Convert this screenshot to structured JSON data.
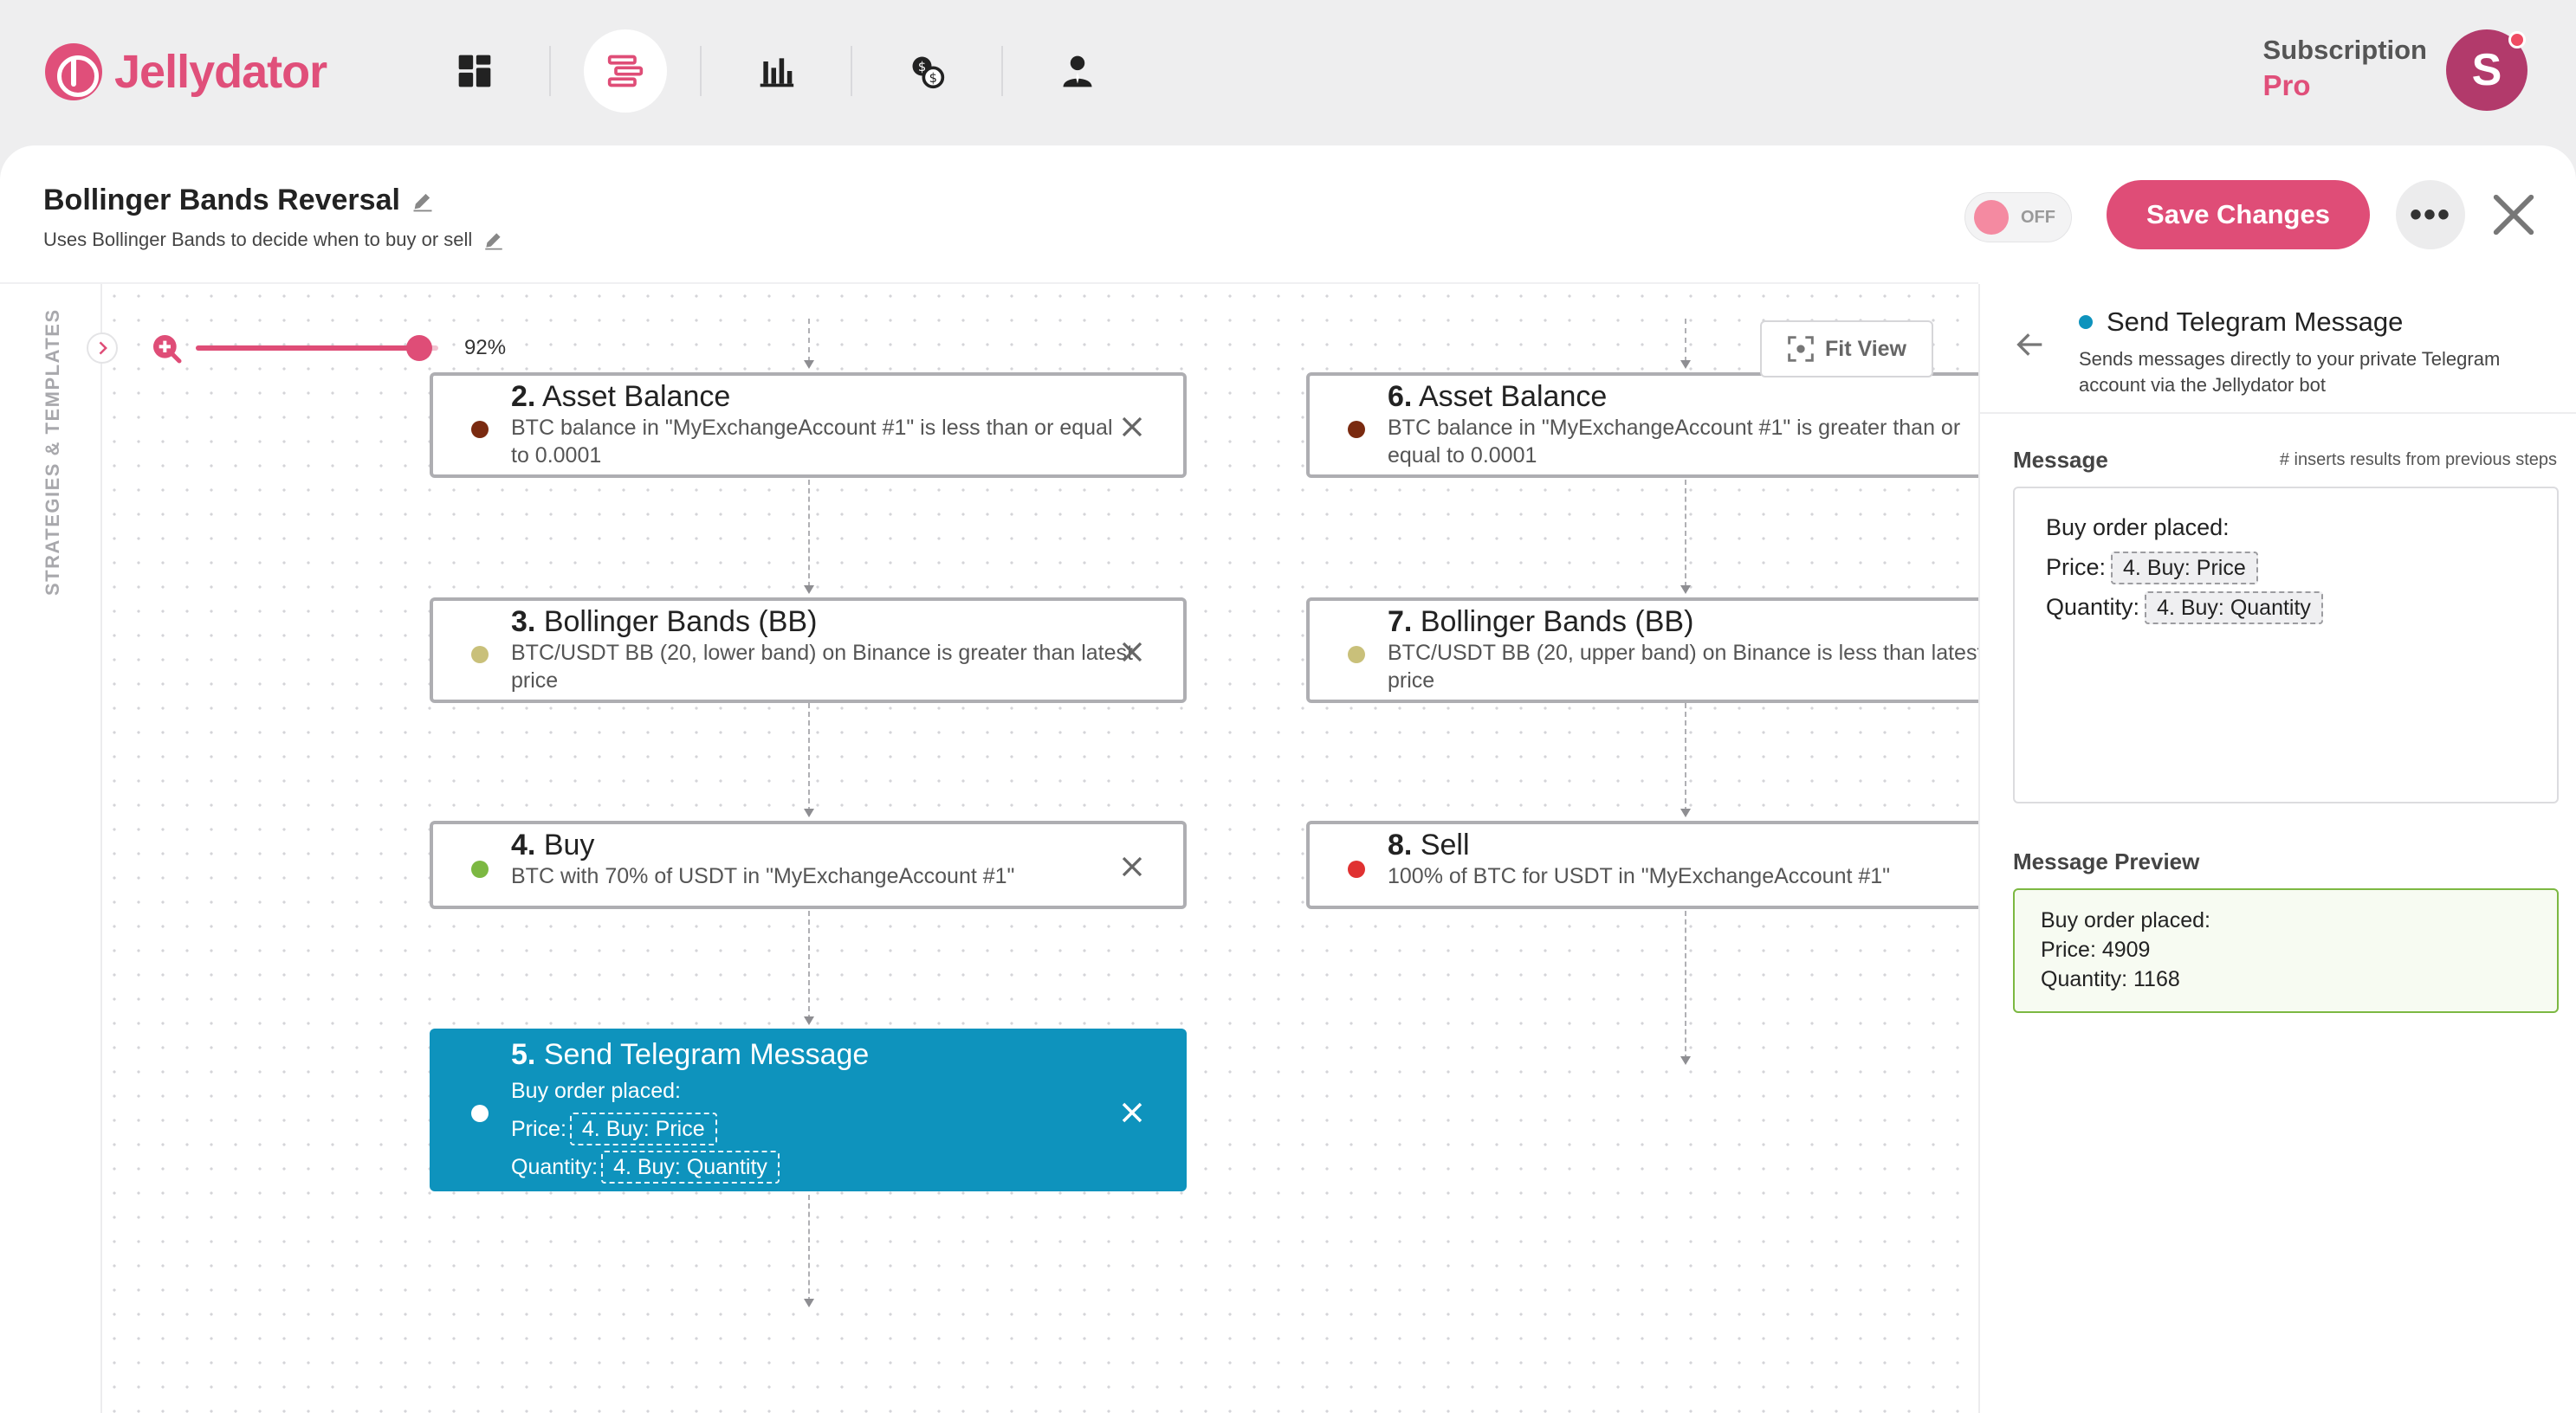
{
  "app": {
    "name": "Jellydator"
  },
  "nav": {
    "items": [
      {
        "icon": "dashboard-icon",
        "active": false
      },
      {
        "icon": "strategies-icon",
        "active": true
      },
      {
        "icon": "bar-chart-icon",
        "active": false
      },
      {
        "icon": "exchange-icon",
        "active": false
      },
      {
        "icon": "account-icon",
        "active": false
      }
    ]
  },
  "subscription": {
    "label": "Subscription",
    "plan": "Pro"
  },
  "user": {
    "avatar_letter": "S"
  },
  "strategy": {
    "title": "Bollinger Bands Reversal",
    "description": "Uses Bollinger Bands to decide when to buy or sell",
    "toggle_label": "OFF",
    "save_label": "Save Changes",
    "more_label": "•••"
  },
  "sidebar": {
    "label": "STRATEGIES & TEMPLATES"
  },
  "canvas": {
    "zoom_value": "92%",
    "zoom_fraction": 0.92,
    "fit_view_label": "Fit View"
  },
  "nodes": {
    "n2": {
      "num": "2.",
      "title": "Asset Balance",
      "desc": "BTC balance in \"MyExchangeAccount #1\" is less than or equal to 0.0001",
      "dot_color": "#7a2a10"
    },
    "n3": {
      "num": "3.",
      "title": "Bollinger Bands (BB)",
      "desc": "BTC/USDT BB (20, lower band) on Binance is greater than latest price",
      "dot_color": "#c9c07a"
    },
    "n4": {
      "num": "4.",
      "title": "Buy",
      "desc": "BTC with 70% of USDT in \"MyExchangeAccount #1\"",
      "dot_color": "#7cb842"
    },
    "n5": {
      "num": "5.",
      "title": "Send Telegram Message",
      "line1": "Buy order placed:",
      "price_label": "Price:",
      "price_token": "4. Buy: Price",
      "qty_label": "Quantity:",
      "qty_token": "4. Buy: Quantity",
      "dot_color": "#ffffff"
    },
    "n6": {
      "num": "6.",
      "title": "Asset Balance",
      "desc": "BTC balance in \"MyExchangeAccount #1\" is greater than or equal to 0.0001",
      "dot_color": "#7a2a10"
    },
    "n7": {
      "num": "7.",
      "title": "Bollinger Bands (BB)",
      "desc": "BTC/USDT BB (20, upper band) on Binance is less than latest price",
      "dot_color": "#c9c07a"
    },
    "n8": {
      "num": "8.",
      "title": "Sell",
      "desc": "100% of BTC for USDT in \"MyExchangeAccount #1\"",
      "dot_color": "#e03131"
    }
  },
  "panel": {
    "title": "Send Telegram Message",
    "description": "Sends messages directly to your private Telegram account via the Jellydator bot",
    "message_label": "Message",
    "message_hint": "# inserts results from previous steps",
    "message": {
      "line1": "Buy order placed:",
      "price_label": "Price:",
      "price_token": "4. Buy: Price",
      "qty_label": "Quantity:",
      "qty_token": "4. Buy: Quantity"
    },
    "preview_label": "Message Preview",
    "preview": {
      "line1": "Buy order placed:",
      "line2": "Price: 4909",
      "line3": "Quantity: 1168"
    }
  }
}
